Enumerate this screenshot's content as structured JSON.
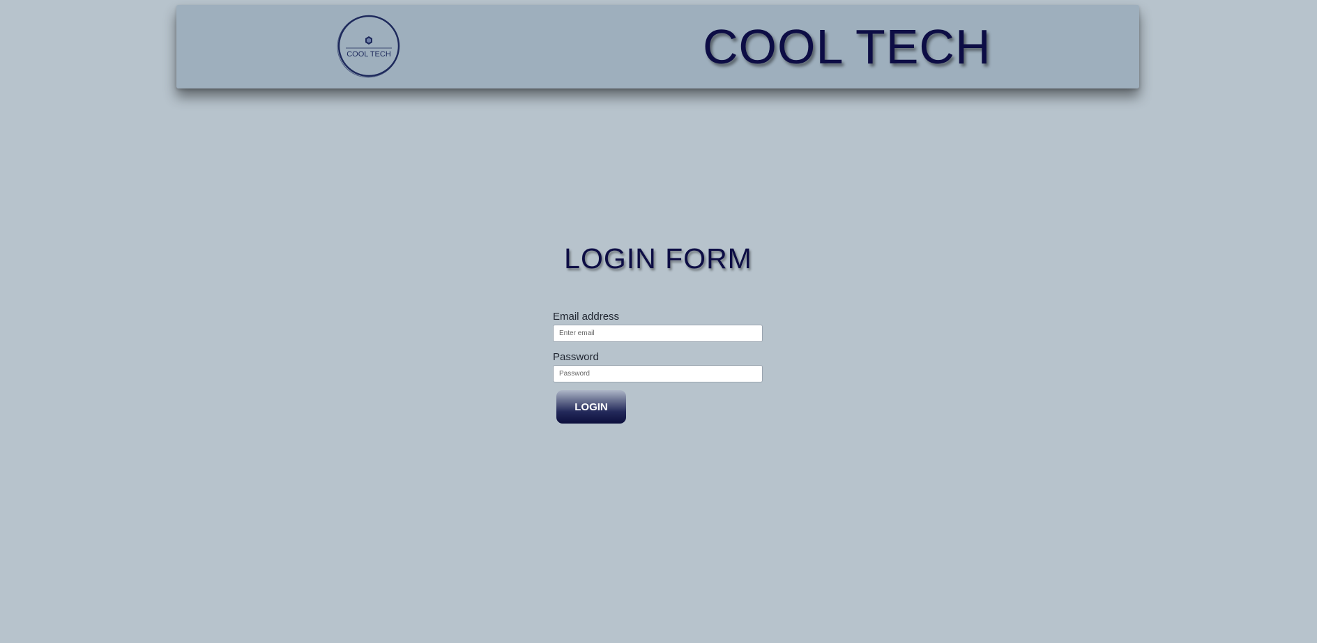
{
  "header": {
    "logo_text": "COOL TECH",
    "title": "COOL TECH"
  },
  "main": {
    "title": "LOGIN FORM"
  },
  "form": {
    "email_label": "Email address",
    "email_placeholder": "Enter email",
    "email_value": "",
    "password_label": "Password",
    "password_placeholder": "Password",
    "password_value": "",
    "login_label": "LOGIN"
  },
  "colors": {
    "background": "#b7c3cc",
    "header_background": "#9eafbd",
    "title_color": "#0d0d45",
    "button_dark": "#0c0f3c"
  },
  "icons": {
    "logo": "cool-tech-logo"
  }
}
